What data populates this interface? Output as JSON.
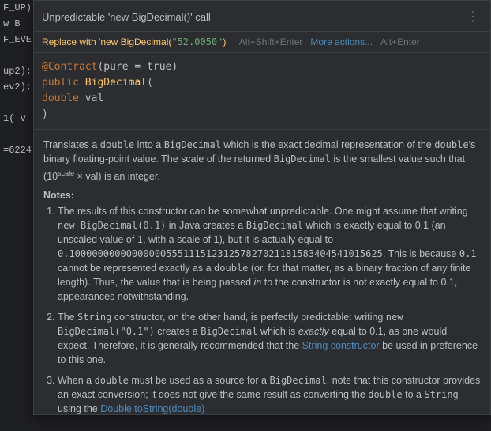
{
  "background": {
    "leftLines": [
      "F_UP)",
      "w B",
      "F_EVE",
      "",
      "up2);",
      "ev2);",
      "",
      "1( v",
      "",
      "=6224",
      "",
      "",
      "",
      "",
      "",
      "",
      "",
      "",
      "",
      "",
      "",
      "",
      "",
      "",
      "",
      "",
      ""
    ]
  },
  "popup": {
    "title": "Unpredictable 'new BigDecimal()' call",
    "menuIcon": "⋮",
    "quickfix": {
      "prefix": "Replace with 'new BigDecimal(\"52.0050\")'",
      "shortcut1": "Alt+Shift+Enter",
      "moreActions": "More actions...",
      "shortcut2": "Alt+Enter"
    },
    "codeSnippet": {
      "line1_annotation": "@Contract",
      "line1_parens": "(pure = true)",
      "line2_public": "public",
      "line2_class": "BigDecimal",
      "line2_paren": "(",
      "line3_indent": "    ",
      "line3_type": "double",
      "line3_var": " val",
      "line4_close": ")"
    },
    "description": {
      "mainText": "Translates a double into a BigDecimal which is the exact decimal representation of the double's binary floating-point value. The scale of the returned BigDecimal is the smallest value such that (10",
      "superscript": "scale",
      "mainTextEnd": " × val) is an integer.",
      "notesLabel": "Notes:",
      "notes": [
        "The results of this constructor can be somewhat unpredictable. One might assume that writing new BigDecimal(0.1) in Java creates a BigDecimal which is exactly equal to 0.1 (an unscaled value of 1, with a scale of 1), but it is actually equal to 0.1000000000000000055511151231257827021181583404541015625. This is because 0.1 cannot be represented exactly as a double (or, for that matter, as a binary fraction of any finite length). Thus, the value that is being passed in to the constructor is not exactly equal to 0.1, appearances notwithstanding.",
        "The String constructor, on the other hand, is perfectly predictable: writing new BigDecimal(\"0.1\") creates a BigDecimal which is exactly equal to 0.1, as one would expect. Therefore, it is generally recommended that the String constructor be used in preference to this one.",
        "When a double must be used as a source for a BigDecimal, note that this constructor provides an exact conversion; it does not give the same result as converting the double to a String using the Double.toString(double)"
      ]
    }
  }
}
